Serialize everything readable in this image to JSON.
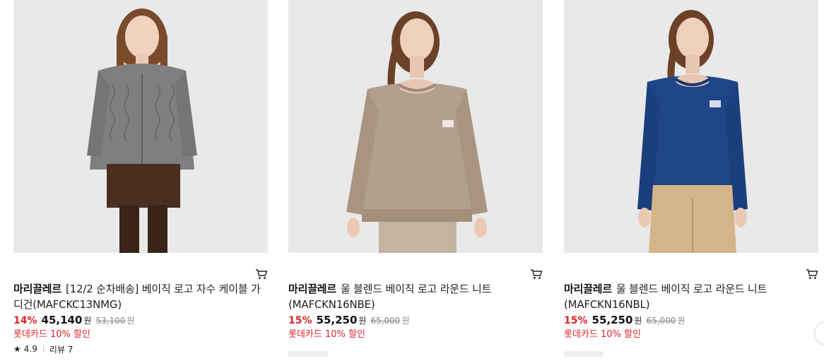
{
  "products": [
    {
      "brand": "마리끌레르",
      "name": "[12/2 순차배송] 베이직 로고 자수 케이블 가디건(MAFCKC13NMG)",
      "discount": "14%",
      "price": "45,140",
      "currency": "원",
      "original_price": "53,100",
      "card_promo": "롯데카드 10% 할인",
      "rating": "4.9",
      "review": "리뷰 7",
      "image": "model-grey-cable-cardigan",
      "garment_color": "#7f7f7f"
    },
    {
      "brand": "마리끌레르",
      "name": "울 블렌드 베이직 로고 라운드 니트(MAFCKN16NBE)",
      "discount": "15%",
      "price": "55,250",
      "currency": "원",
      "original_price": "65,000",
      "card_promo": "롯데카드 10% 할인",
      "image": "model-beige-round-knit",
      "garment_color": "#b3a08c"
    },
    {
      "brand": "마리끌레르",
      "name": "울 블렌드 베이직 로고 라운드 니트(MAFCKN16NBL)",
      "discount": "15%",
      "price": "55,250",
      "currency": "원",
      "original_price": "65,000",
      "card_promo": "롯데카드 10% 할인",
      "image": "model-blue-round-knit",
      "garment_color": "#1e4587"
    }
  ],
  "icons": {
    "cart": "cart-icon",
    "star": "star-icon"
  },
  "colors": {
    "discount": "#e0242b",
    "card_promo": "#e0242b",
    "photo_bg": "#e9e9e9"
  }
}
